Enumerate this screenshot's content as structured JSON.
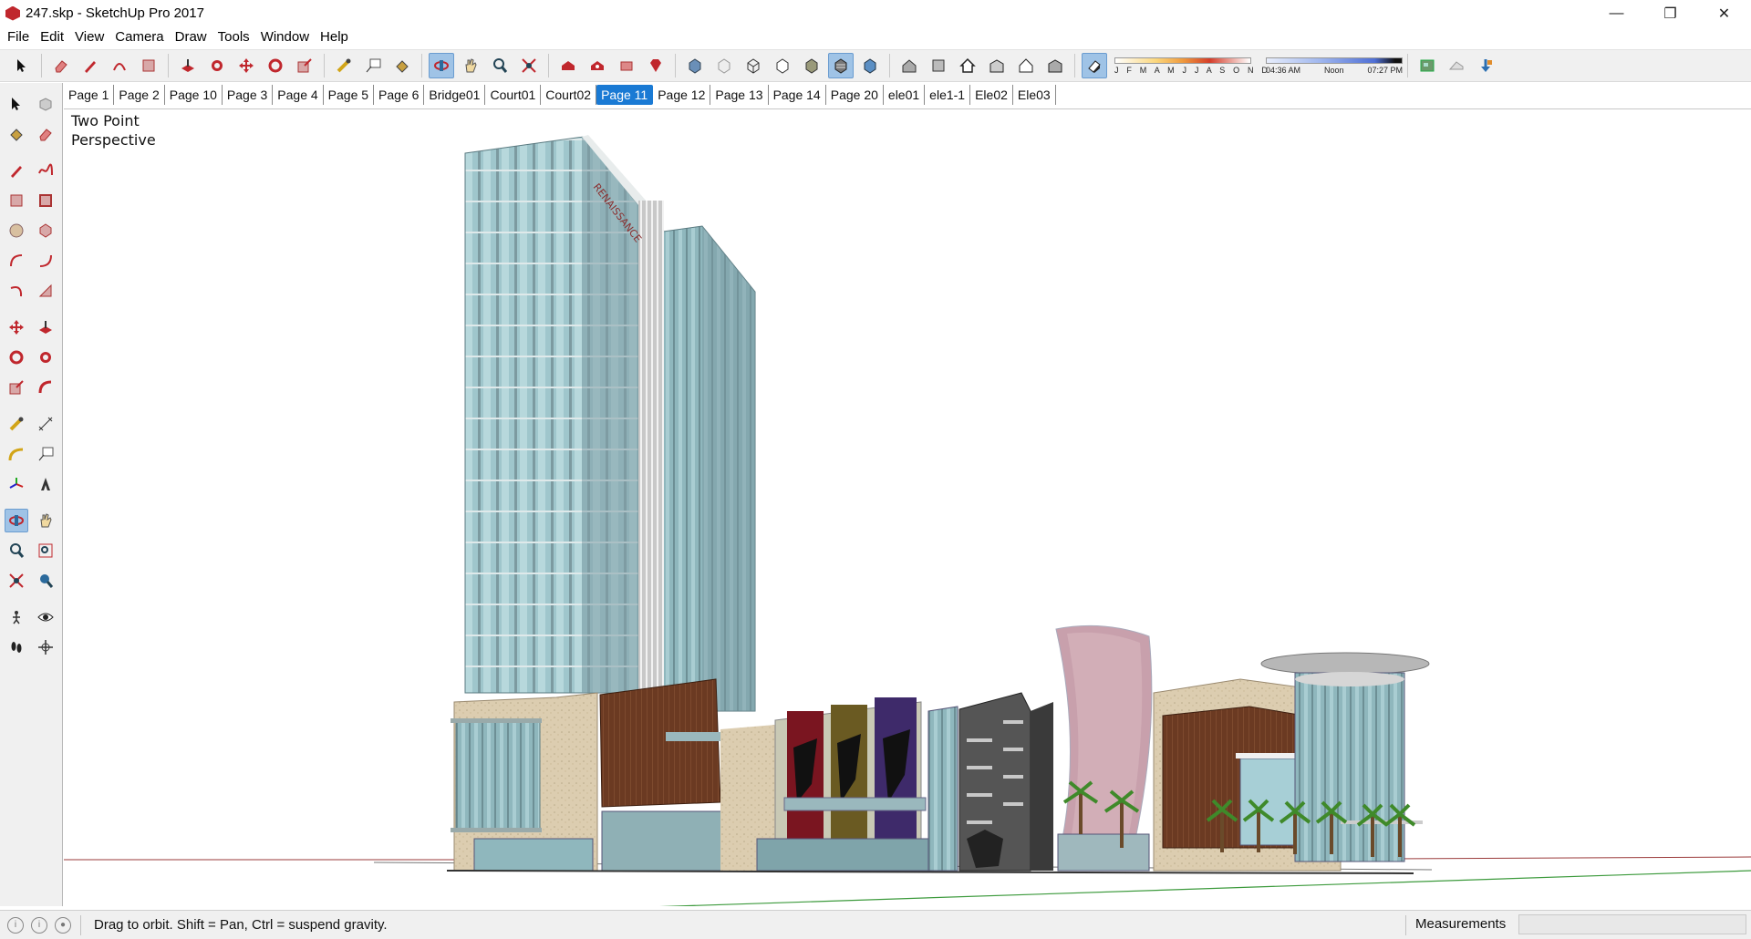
{
  "window": {
    "title": "247.skp - SketchUp Pro 2017",
    "minimize_glyph": "—",
    "restore_glyph": "❐",
    "close_glyph": "✕"
  },
  "menu": {
    "items": [
      "File",
      "Edit",
      "View",
      "Camera",
      "Draw",
      "Tools",
      "Window",
      "Help"
    ]
  },
  "shadow": {
    "months_label": "J F M A M J J A S O N D",
    "time_start": "04:36 AM",
    "time_mid": "Noon",
    "time_end": "07:27 PM"
  },
  "scenes": {
    "tabs": [
      "Page 1",
      "Page 2",
      "Page 10",
      "Page 3",
      "Page 4",
      "Page 5",
      "Page 6",
      "Bridge01",
      "Court01",
      "Court02",
      "Page 11",
      "Page 12",
      "Page 13",
      "Page 14",
      "Page 20",
      "ele01",
      "ele1-1",
      "Ele02",
      "Ele03"
    ],
    "active": "Page 11"
  },
  "viewport": {
    "camera_line1": "Two Point",
    "camera_line2": "Perspective"
  },
  "status": {
    "hint": "Drag to orbit. Shift = Pan, Ctrl = suspend gravity.",
    "measurements_label": "Measurements",
    "measurements_value": ""
  },
  "colors": {
    "accent_active_tab": "#1a7ad4",
    "tool_active": "#9fc3e6"
  }
}
